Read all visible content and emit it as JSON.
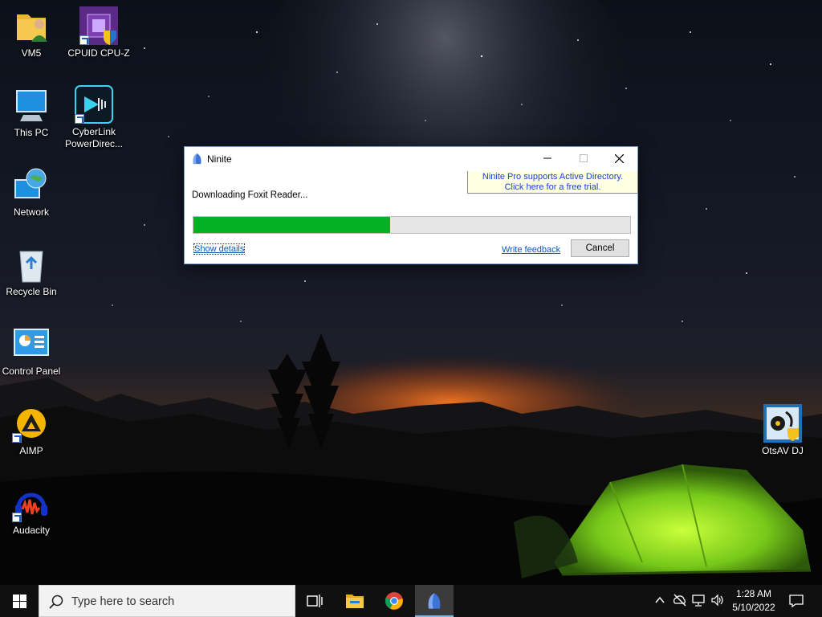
{
  "desktop": {
    "icons": [
      {
        "label": "VM5"
      },
      {
        "label": "CPUID CPU-Z"
      },
      {
        "label": "This PC"
      },
      {
        "label": "CyberLink PowerDirec..."
      },
      {
        "label": "Network"
      },
      {
        "label": "Recycle Bin"
      },
      {
        "label": "Control Panel"
      },
      {
        "label": "AIMP"
      },
      {
        "label": "Audacity"
      },
      {
        "label": "OtsAV DJ"
      }
    ]
  },
  "dialog": {
    "title": "Ninite",
    "promo_line1": "Ninite Pro supports Active Directory.",
    "promo_line2": "Click here for a free trial.",
    "status": "Downloading Foxit Reader...",
    "progress_fraction": 0.45,
    "show_details": "Show details",
    "write_feedback": "Write feedback",
    "cancel": "Cancel"
  },
  "taskbar": {
    "search_placeholder": "Type here to search",
    "time": "1:28 AM",
    "date": "5/10/2022"
  },
  "colors": {
    "progress_fill": "#06b025",
    "link": "#0a58c2",
    "promo_bg": "#ffffe1",
    "taskbar": "#101010"
  }
}
